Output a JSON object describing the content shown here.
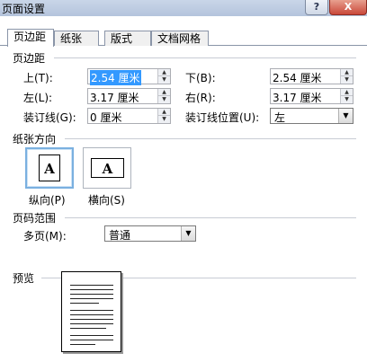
{
  "window": {
    "title": "页面设置",
    "help_glyph": "?",
    "close_glyph": "X"
  },
  "tabs": [
    {
      "label": "页边距"
    },
    {
      "label": "纸张"
    },
    {
      "label": "版式"
    },
    {
      "label": "文档网格"
    }
  ],
  "margins": {
    "group_label": "页边距",
    "top": {
      "label": "上(T):",
      "value": "2.54 厘米"
    },
    "bottom": {
      "label": "下(B):",
      "value": "2.54 厘米"
    },
    "left": {
      "label": "左(L):",
      "value": "3.17 厘米"
    },
    "right": {
      "label": "右(R):",
      "value": "3.17 厘米"
    },
    "gutter": {
      "label": "装订线(G):",
      "value": "0 厘米"
    },
    "gutter_position": {
      "label": "装订线位置(U):",
      "value": "左"
    }
  },
  "orientation": {
    "group_label": "纸张方向",
    "portrait": {
      "label": "纵向(P)",
      "glyph": "A"
    },
    "landscape": {
      "label": "横向(S)",
      "glyph": "A"
    }
  },
  "pages": {
    "group_label": "页码范围",
    "multiple_label": "多页(M):",
    "multiple_value": "普通"
  },
  "preview": {
    "group_label": "预览"
  },
  "icons": {
    "spin": "spin-arrows-icon",
    "dropdown": "dropdown-arrow-icon"
  }
}
